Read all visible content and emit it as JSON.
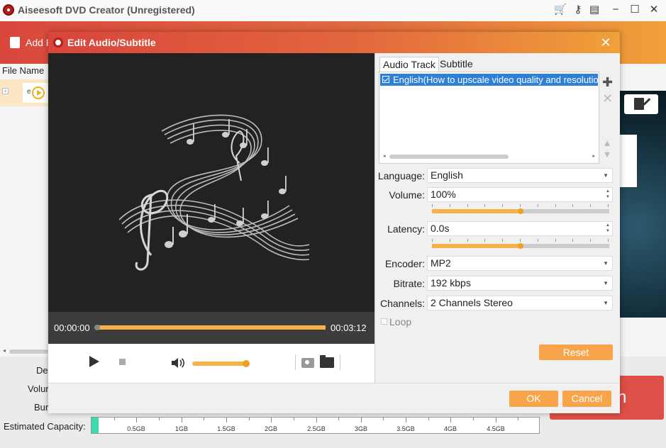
{
  "app": {
    "title": "Aiseesoft DVD Creator (Unregistered)"
  },
  "toolbar": {
    "add_label": "Add F"
  },
  "file_list": {
    "header": "File Name",
    "row_label": "e"
  },
  "bottom": {
    "labels": [
      "De",
      "Volur",
      "Bur"
    ],
    "capacity_label": "Estimated Capacity:",
    "capacity_ticks": [
      "0.5GB",
      "1GB",
      "1.5GB",
      "2GB",
      "2.5GB",
      "3GB",
      "3.5GB",
      "4GB",
      "4.5GB"
    ],
    "capacity_used": 0.015,
    "burn_label": "rn"
  },
  "dialog": {
    "title": "Edit Audio/Subtitle",
    "close_label": "✕",
    "player": {
      "current_time": "00:00:00",
      "total_time": "00:03:12",
      "progress": 0.0,
      "volume": 0.98
    },
    "tabs": [
      "Audio Track",
      "Subtitle"
    ],
    "active_tab": "Audio Track",
    "tracks": [
      {
        "label": "English(How to upscale video quality and resolution",
        "checked": true
      }
    ],
    "form": {
      "language_label": "Language:",
      "language_value": "English",
      "volume_label": "Volume:",
      "volume_value": "100%",
      "volume_slider": 0.5,
      "latency_label": "Latency:",
      "latency_value": "0.0s",
      "latency_slider": 0.5,
      "encoder_label": "Encoder:",
      "encoder_value": "MP2",
      "bitrate_label": "Bitrate:",
      "bitrate_value": "192 kbps",
      "channels_label": "Channels:",
      "channels_value": "2 Channels Stereo",
      "loop_label": "Loop"
    },
    "reset_label": "Reset",
    "ok_label": "OK",
    "cancel_label": "Cancel"
  }
}
